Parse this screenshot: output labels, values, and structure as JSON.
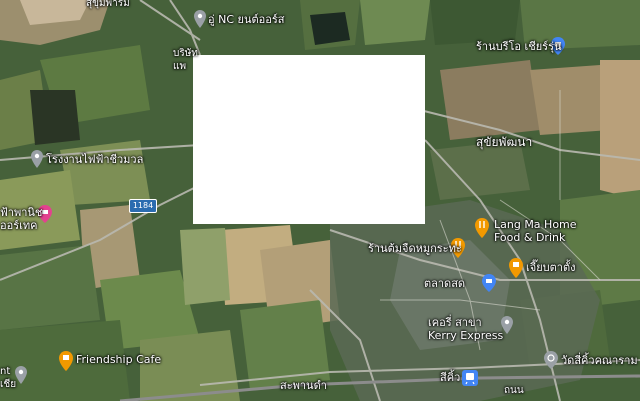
{
  "labels": {
    "top_left_cut": "สุขุมพาร์ม",
    "nc_car": "อู่ NC ยนต์ออร์ส",
    "company_cut": "บริษัท",
    "company_cut2": "แพ",
    "power_plant": "โรงงานไฟฟ้าชีวมวล",
    "fapa_line1": "ฟ้าพานิช",
    "fapa_line2": "ออร์เทค",
    "route_number": "1184",
    "shop_top_right": "ร้านบรีโอ เชียร์รุ่น",
    "village": "สุขัยพัฒนา",
    "lang_ma_1": "Lang Ma Home",
    "lang_ma_2": "Food & Drink",
    "restaurant": "ร้านต้มจืดหมูกระทะ",
    "cafe_right": "เจี๊ยบตาตั้ง",
    "market": "ตลาดสด",
    "kerry_th": "เคอรี่ สาขา",
    "kerry_en": "Kerry Express",
    "temple": "วัดสี่คิ้วคณาราม",
    "friendship": "Friendship Cafe",
    "left_edge_1": "nt",
    "left_edge_2": "เชีย",
    "station_road": "สะพานดำ",
    "train_station": "สีคิ้ว",
    "bottom_right": "ถนน"
  },
  "icon_colors": {
    "place_pin": "#9aa0a6",
    "food_pin": "#f29900",
    "shopping_pin": "#4285f4",
    "shop_pink": "#e3418f",
    "temple_pin": "#9aa0a6"
  }
}
